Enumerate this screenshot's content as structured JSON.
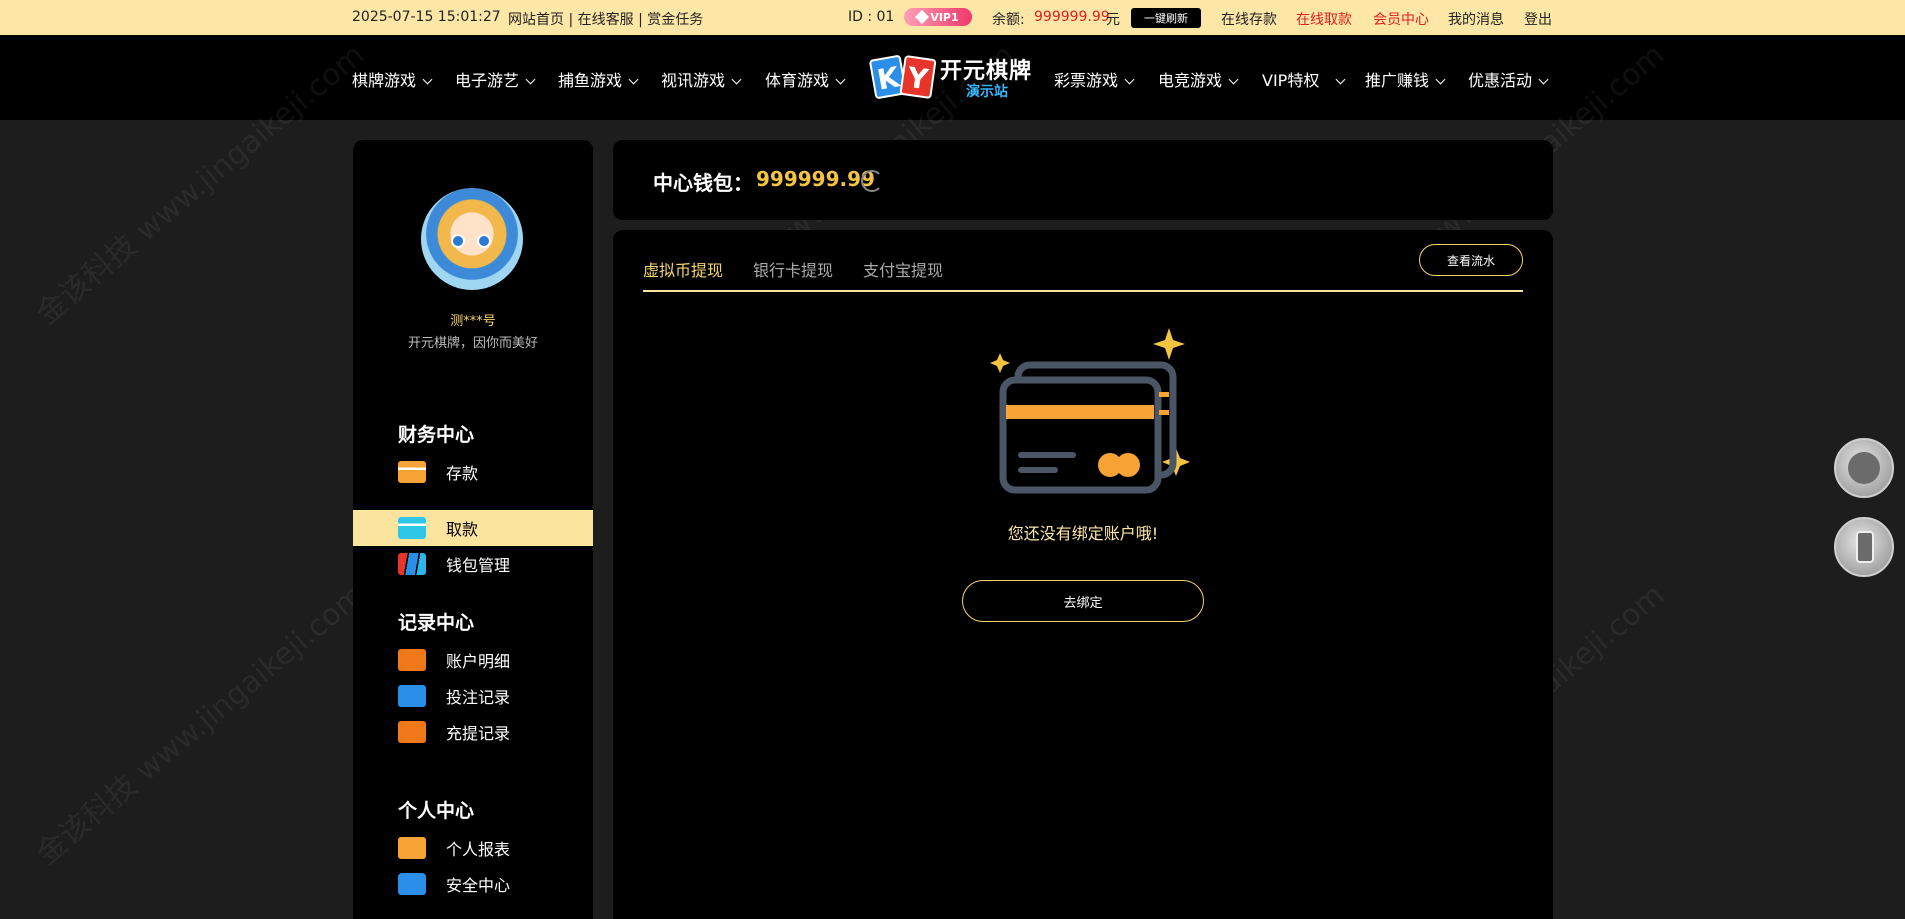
{
  "topbar": {
    "timestamp": "2025-07-15 15:01:27",
    "links": "网站首页 | 在线客服 | 赏金任务",
    "user_id": "ID : 01",
    "vip": "VIP1",
    "balance_label": "余额:",
    "balance_value": "999999.99",
    "balance_unit": "元",
    "refresh_label": "一键刷新",
    "nav": [
      "在线存款",
      "在线取款",
      "会员中心",
      "我的消息",
      "登出"
    ]
  },
  "mainnav": {
    "left": [
      "棋牌游戏",
      "电子游艺",
      "捕鱼游戏",
      "视讯游戏",
      "体育游戏"
    ],
    "right": [
      "彩票游戏",
      "电竞游戏",
      "VIP特权",
      "推广赚钱",
      "优惠活动"
    ],
    "logo_title": "开元棋牌",
    "logo_sub": "演示站"
  },
  "sidebar": {
    "username": "测***号",
    "slogan": "开元棋牌，因你而美好",
    "sections": [
      {
        "title": "财务中心",
        "items": [
          "存款",
          "取款",
          "钱包管理"
        ]
      },
      {
        "title": "记录中心",
        "items": [
          "账户明细",
          "投注记录",
          "充提记录"
        ]
      },
      {
        "title": "个人中心",
        "items": [
          "个人报表",
          "安全中心"
        ]
      }
    ]
  },
  "wallet": {
    "label": "中心钱包：",
    "value": "999999.99"
  },
  "panel": {
    "tabs": [
      "虚拟币提现",
      "银行卡提现",
      "支付宝提现"
    ],
    "view_flow": "查看流水",
    "empty_message": "您还没有绑定账户哦!",
    "bind_button": "去绑定"
  },
  "watermark": "金该科技 www.jingaikeji.com",
  "colors": {
    "gold": "#f5d56a",
    "topbar_bg": "#fde7a6",
    "active_menu": "#fbe59e",
    "alert_red": "#e02020"
  }
}
